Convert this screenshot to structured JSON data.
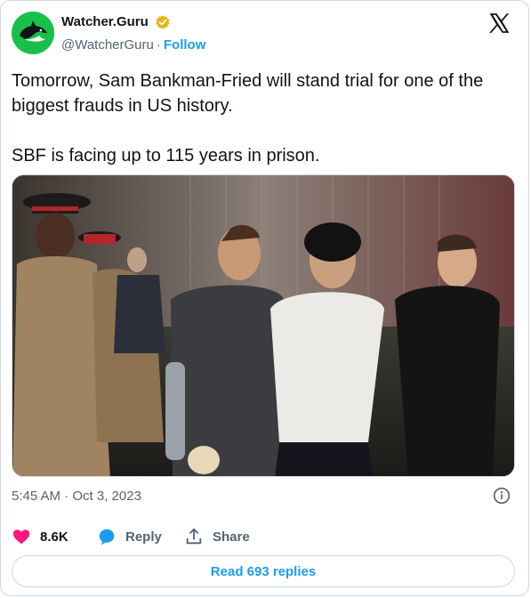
{
  "author": {
    "display_name": "Watcher.Guru",
    "handle": "@WatcherGuru",
    "separator": "·",
    "follow_label": "Follow",
    "verified_color": "#e2b719",
    "avatar_color": "#18c04a"
  },
  "tweet": {
    "text": "Tomorrow, Sam Bankman-Fried will stand trial for one of the biggest frauds in US history.\n\nSBF is facing up to 115 years in prison.",
    "timestamp": "5:45 AM · Oct 3, 2023"
  },
  "actions": {
    "like_count": "8.6K",
    "reply_label": "Reply",
    "share_label": "Share",
    "like_color": "#f91880",
    "reply_color": "#1d9bf0"
  },
  "read_replies_label": "Read 693 replies",
  "icons": [
    "x-logo-icon",
    "verified-badge-icon",
    "info-icon",
    "heart-icon",
    "reply-bubble-icon",
    "share-icon"
  ]
}
